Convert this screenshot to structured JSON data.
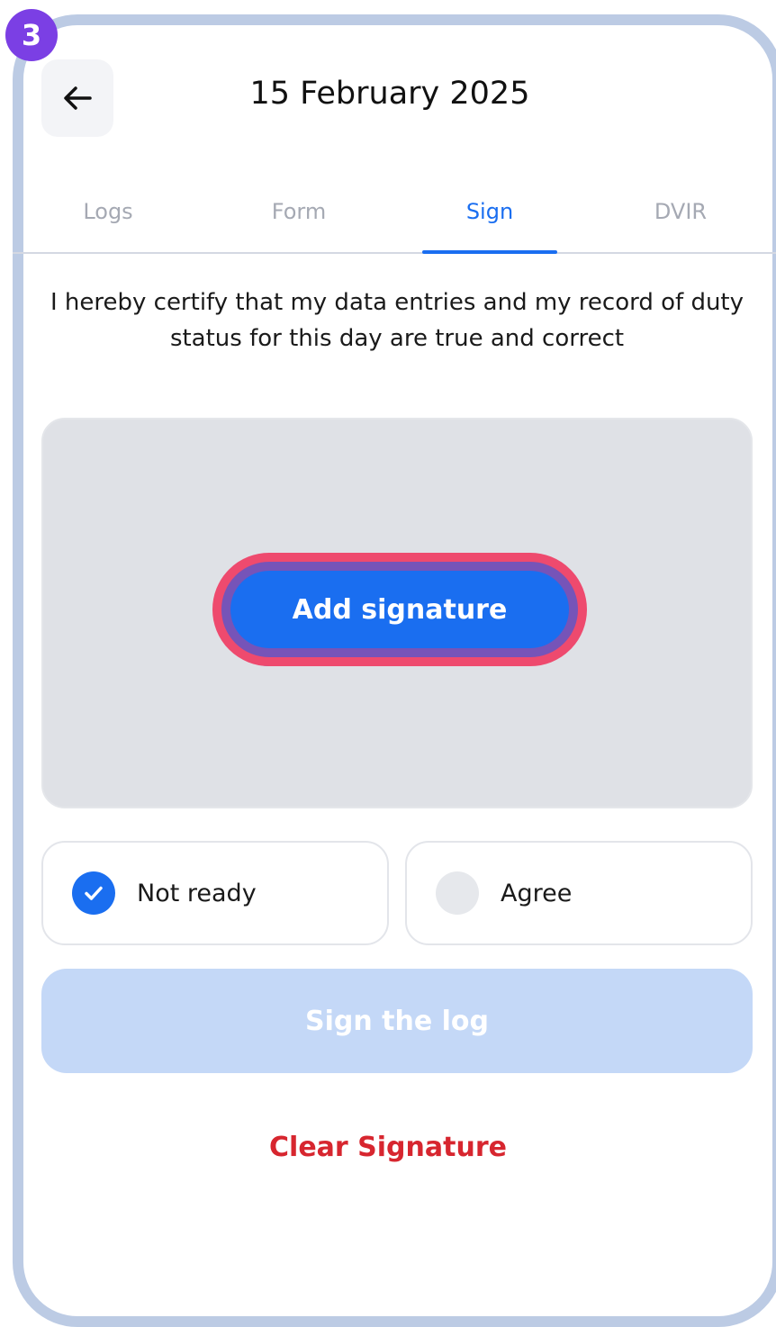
{
  "step_badge": "3",
  "header": {
    "title": "15 February 2025"
  },
  "tabs": [
    {
      "label": "Logs",
      "active": false
    },
    {
      "label": "Form",
      "active": false
    },
    {
      "label": "Sign",
      "active": true
    },
    {
      "label": "DVIR",
      "active": false
    }
  ],
  "certify_text": "I hereby certify that my data entries and my record of duty status for this day are true and correct",
  "signature_pad": {
    "add_signature_label": "Add signature"
  },
  "options": {
    "not_ready": {
      "label": "Not ready",
      "checked": true
    },
    "agree": {
      "label": "Agree",
      "checked": false
    }
  },
  "sign_log_label": "Sign the log",
  "clear_signature_label": "Clear Signature",
  "colors": {
    "accent": "#1a6ef0",
    "highlight_outline": "#ee4a6e",
    "badge": "#7b3fe4",
    "danger": "#d7262f",
    "disabled_button": "#c4d8f7"
  },
  "icons": {
    "back": "arrow-left-icon",
    "check": "check-icon"
  }
}
